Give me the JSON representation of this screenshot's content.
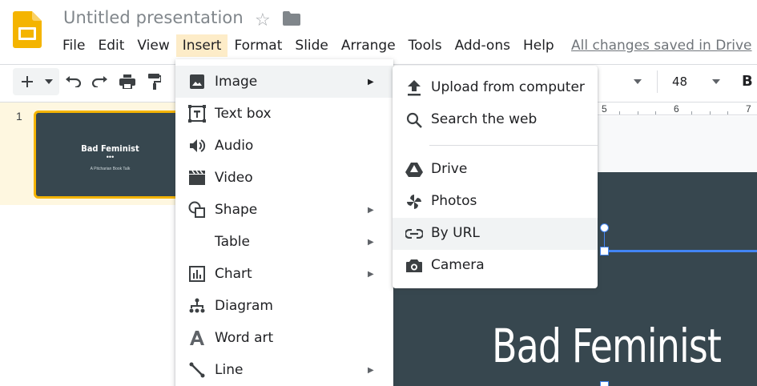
{
  "header": {
    "doc_title": "Untitled presentation",
    "saved_status": "All changes saved in Drive"
  },
  "menubar": [
    "File",
    "Edit",
    "View",
    "Insert",
    "Format",
    "Slide",
    "Arrange",
    "Tools",
    "Add-ons",
    "Help"
  ],
  "toolbar": {
    "font_size": "48",
    "bold_label": "B"
  },
  "ruler": [
    "5",
    "6",
    "7"
  ],
  "filmstrip": {
    "slide_number": "1",
    "thumb_title": "Bad Feminist",
    "thumb_dots": "•••",
    "thumb_subtitle": "A Pitcharian Book Talk"
  },
  "slide": {
    "title": "Bad Feminist"
  },
  "insert_menu": {
    "items": [
      {
        "label": "Image",
        "icon": "image-icon",
        "submenu": true
      },
      {
        "label": "Text box",
        "icon": "text-box-icon",
        "submenu": false
      },
      {
        "label": "Audio",
        "icon": "audio-icon",
        "submenu": false
      },
      {
        "label": "Video",
        "icon": "video-icon",
        "submenu": false
      },
      {
        "label": "Shape",
        "icon": "shape-icon",
        "submenu": true
      },
      {
        "label": "Table",
        "icon": "",
        "submenu": true
      },
      {
        "label": "Chart",
        "icon": "chart-icon",
        "submenu": true
      },
      {
        "label": "Diagram",
        "icon": "diagram-icon",
        "submenu": false
      },
      {
        "label": "Word art",
        "icon": "word-art-icon",
        "submenu": false
      },
      {
        "label": "Line",
        "icon": "line-icon",
        "submenu": true
      }
    ]
  },
  "image_submenu": {
    "items": [
      {
        "label": "Upload from computer",
        "icon": "upload-icon"
      },
      {
        "label": "Search the web",
        "icon": "search-icon"
      },
      {
        "label": "Drive",
        "icon": "drive-icon"
      },
      {
        "label": "Photos",
        "icon": "photos-icon"
      },
      {
        "label": "By URL",
        "icon": "link-icon"
      },
      {
        "label": "Camera",
        "icon": "camera-icon"
      }
    ]
  },
  "colors": {
    "slide_bg": "#37474f",
    "accent_yellow": "#f4b400",
    "selection_blue": "#4285f4",
    "active_menu_bg": "#fdecc8"
  }
}
